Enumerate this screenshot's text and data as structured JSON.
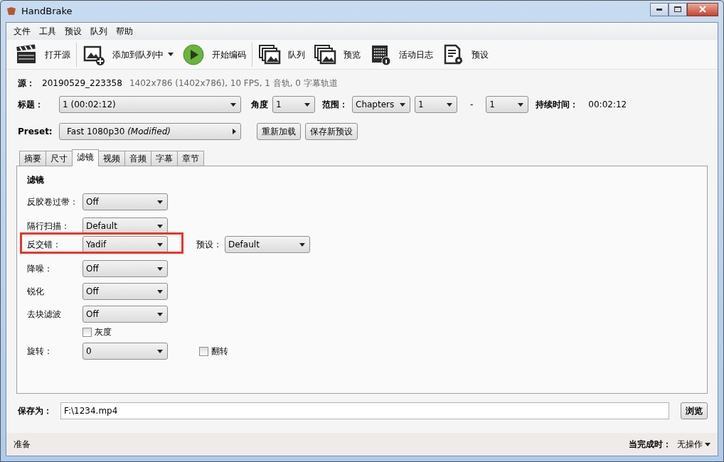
{
  "window": {
    "title": "HandBrake"
  },
  "menu": [
    "文件",
    "工具",
    "预设",
    "队列",
    "帮助"
  ],
  "toolbar": [
    {
      "kind": "open",
      "label": "打开源",
      "dropdown": false,
      "separator_before": false
    },
    {
      "kind": "add",
      "label": "添加到队列中",
      "dropdown": true,
      "separator_before": true
    },
    {
      "kind": "start",
      "label": "开始编码",
      "dropdown": false,
      "separator_before": false
    },
    {
      "kind": "queue",
      "label": "队列",
      "dropdown": false,
      "separator_before": true
    },
    {
      "kind": "preview",
      "label": "预览",
      "dropdown": false,
      "separator_before": false
    },
    {
      "kind": "log",
      "label": "活动日志",
      "dropdown": false,
      "separator_before": false
    },
    {
      "kind": "presets",
      "label": "预设",
      "dropdown": false,
      "separator_before": false
    }
  ],
  "source": {
    "label": "源：",
    "name": "20190529_223358",
    "details": "1402x786 (1402x786), 10 FPS, 1 音轨, 0 字幕轨道"
  },
  "title_row": {
    "title_label": "标题：",
    "title_value": "1  (00:02:12)",
    "angle_label": "角度",
    "angle_value": "1",
    "range_label": "范围：",
    "range_type": "Chapters",
    "range_start": "1",
    "range_separator": "-",
    "range_end": "1",
    "duration_label": "持续时间：",
    "duration": "00:02:12"
  },
  "preset": {
    "label": "Preset:",
    "value": "Fast 1080p30  *(Modified)*",
    "buttons": [
      "重新加载",
      "保存新预设"
    ]
  },
  "tabs": [
    {
      "label": "摘要",
      "selected": false
    },
    {
      "label": "尺寸",
      "selected": false
    },
    {
      "label": "滤镜",
      "selected": true
    },
    {
      "label": "视频",
      "selected": false
    },
    {
      "label": "音频",
      "selected": false
    },
    {
      "label": "字幕",
      "selected": false
    },
    {
      "label": "章节",
      "selected": false
    }
  ],
  "filters": {
    "heading": "滤镜",
    "rows": [
      {
        "kind": "select",
        "label": "反胶卷过带：",
        "value": "Off",
        "highlighted": false
      },
      {
        "kind": "select",
        "label": "隔行扫描：",
        "value": "Default",
        "highlighted": false
      },
      {
        "kind": "select",
        "label": "反交错：",
        "value": "Yadif",
        "highlighted": true,
        "extra_select": {
          "label": "预设：",
          "value": "Default"
        }
      },
      {
        "kind": "select",
        "label": "降噪：",
        "value": "Off",
        "highlighted": false
      },
      {
        "kind": "select",
        "label": "锐化",
        "value": "Off",
        "highlighted": false
      },
      {
        "kind": "select",
        "label": "去块滤波",
        "value": "Off",
        "highlighted": false
      },
      {
        "kind": "checkbox",
        "label": "灰度",
        "checked": false
      },
      {
        "kind": "select",
        "label": "旋转：",
        "value": "0",
        "highlighted": false,
        "extra_checkbox": {
          "label": "翻转",
          "checked": false
        }
      }
    ]
  },
  "save_as": {
    "label": "保存为：",
    "value": "F:\\1234.mp4",
    "button": "浏览"
  },
  "status_bar": {
    "status": "准备",
    "when_done_label": "当完成时：",
    "when_done": "无操作"
  }
}
